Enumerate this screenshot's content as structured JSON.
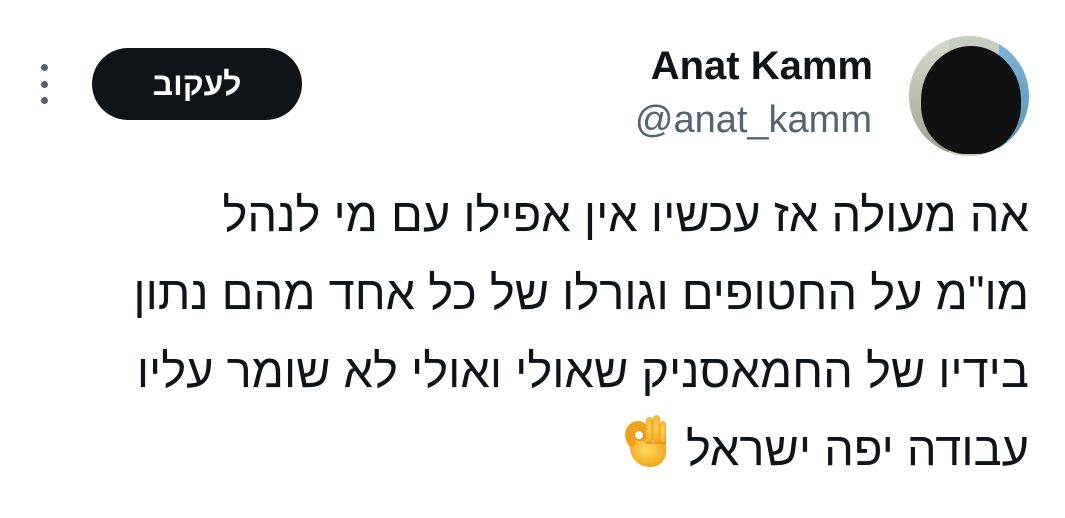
{
  "author": {
    "display_name": "Anat Kamm",
    "handle": "@anat_kamm"
  },
  "actions": {
    "follow_label": "לעקוב"
  },
  "tweet": {
    "lines": [
      "אה מעולה אז עכשיו אין אפילו עם מי לנהל",
      "מו\"מ על החטופים וגורלו של כל אחד מהם נתון",
      "בידיו של החמאסניק שאולי ואולי לא שומר עליו",
      "עבודה יפה ישראל"
    ],
    "emoji": "ok-hand-emoji"
  }
}
